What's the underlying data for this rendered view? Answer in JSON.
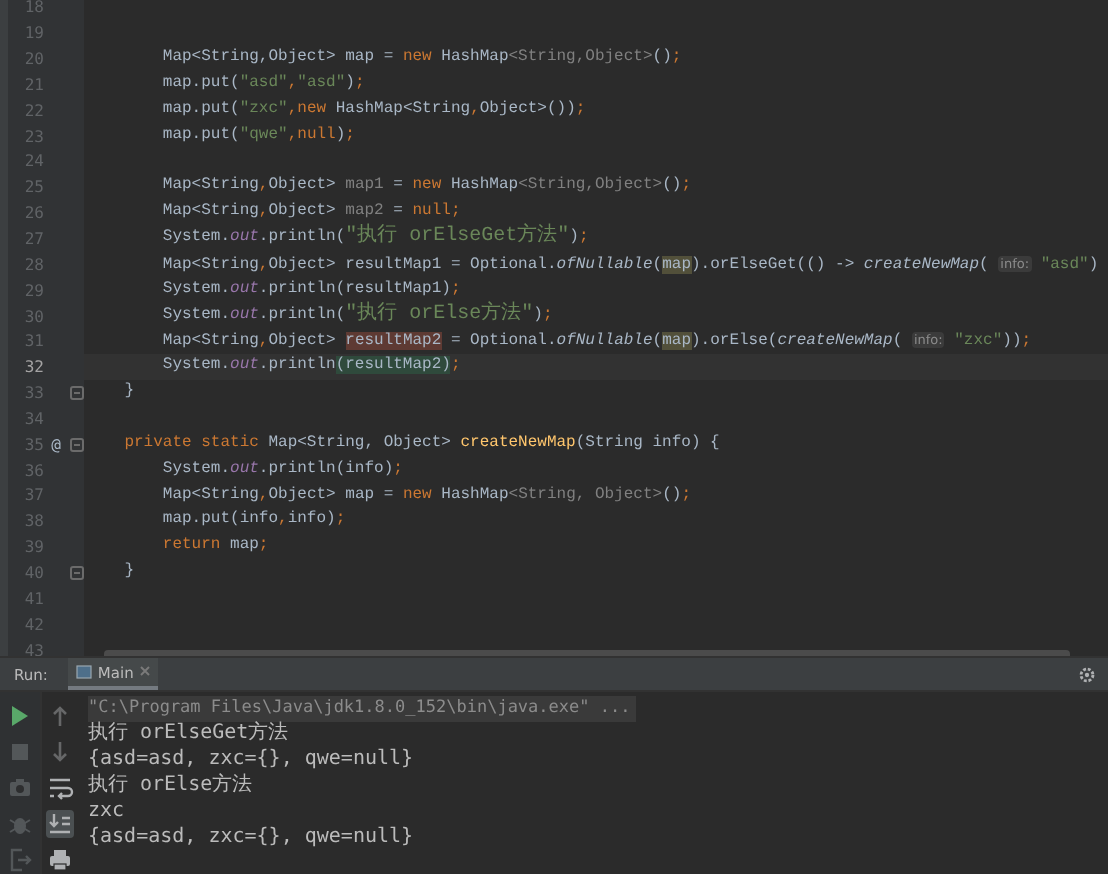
{
  "editor": {
    "lines": [
      {
        "number": "18",
        "current": false,
        "fold": false
      },
      {
        "number": "19",
        "current": false,
        "fold": false
      },
      {
        "number": "20",
        "current": false,
        "fold": false,
        "tokens": [
          {
            "kind": "plain",
            "text": "        Map<String,Object> map = "
          },
          {
            "kind": "keyword",
            "text": "new "
          },
          {
            "kind": "plain",
            "text": "HashMap"
          },
          {
            "kind": "dim",
            "text": "<String,Object>"
          },
          {
            "kind": "plain",
            "text": "()"
          },
          {
            "kind": "keyword",
            "text": ";"
          }
        ]
      },
      {
        "number": "21",
        "current": false,
        "fold": false,
        "tokens": [
          {
            "kind": "plain",
            "text": "        map.put("
          },
          {
            "kind": "string",
            "text": "\"asd\""
          },
          {
            "kind": "keyword",
            "text": ","
          },
          {
            "kind": "string",
            "text": "\"asd\""
          },
          {
            "kind": "plain",
            "text": ")"
          },
          {
            "kind": "keyword",
            "text": ";"
          }
        ]
      },
      {
        "number": "22",
        "current": false,
        "fold": false,
        "tokens": [
          {
            "kind": "plain",
            "text": "        map.put("
          },
          {
            "kind": "string",
            "text": "\"zxc\""
          },
          {
            "kind": "keyword",
            "text": ","
          },
          {
            "kind": "keyword",
            "text": "new "
          },
          {
            "kind": "plain",
            "text": "HashMap<String"
          },
          {
            "kind": "keyword",
            "text": ","
          },
          {
            "kind": "plain",
            "text": "Object>())"
          },
          {
            "kind": "keyword",
            "text": ";"
          }
        ]
      },
      {
        "number": "23",
        "current": false,
        "fold": false,
        "tokens": [
          {
            "kind": "plain",
            "text": "        map.put("
          },
          {
            "kind": "string",
            "text": "\"qwe\""
          },
          {
            "kind": "keyword",
            "text": ","
          },
          {
            "kind": "keyword",
            "text": "null"
          },
          {
            "kind": "plain",
            "text": ")"
          },
          {
            "kind": "keyword",
            "text": ";"
          }
        ]
      },
      {
        "number": "24",
        "current": false,
        "fold": false
      },
      {
        "number": "25",
        "current": false,
        "fold": false,
        "tokens": [
          {
            "kind": "plain",
            "text": "        Map<String"
          },
          {
            "kind": "keyword",
            "text": ","
          },
          {
            "kind": "plain",
            "text": "Object> "
          },
          {
            "kind": "dim",
            "text": "map1"
          },
          {
            "kind": "plain",
            "text": " = "
          },
          {
            "kind": "keyword",
            "text": "new "
          },
          {
            "kind": "plain",
            "text": "HashMap"
          },
          {
            "kind": "dim",
            "text": "<String,Object>"
          },
          {
            "kind": "plain",
            "text": "()"
          },
          {
            "kind": "keyword",
            "text": ";"
          }
        ]
      },
      {
        "number": "26",
        "current": false,
        "fold": false,
        "tokens": [
          {
            "kind": "plain",
            "text": "        Map<String"
          },
          {
            "kind": "keyword",
            "text": ","
          },
          {
            "kind": "plain",
            "text": "Object> "
          },
          {
            "kind": "dim",
            "text": "map2"
          },
          {
            "kind": "plain",
            "text": " = "
          },
          {
            "kind": "keyword",
            "text": "null;"
          }
        ]
      },
      {
        "number": "27",
        "current": false,
        "fold": false,
        "tokens": [
          {
            "kind": "plain",
            "text": "        System."
          },
          {
            "kind": "field",
            "text": "out"
          },
          {
            "kind": "plain",
            "text": ".println("
          },
          {
            "kind": "cjk-string",
            "text": "\"执行 orElseGet方法\""
          },
          {
            "kind": "plain",
            "text": ")"
          },
          {
            "kind": "keyword",
            "text": ";"
          }
        ]
      },
      {
        "number": "28",
        "current": false,
        "fold": false,
        "tokens": [
          {
            "kind": "plain",
            "text": "        Map<String"
          },
          {
            "kind": "keyword",
            "text": ","
          },
          {
            "kind": "plain",
            "text": "Object> resultMap1 = Optional."
          },
          {
            "kind": "italic",
            "text": "ofNullable"
          },
          {
            "kind": "plain",
            "text": "("
          },
          {
            "kind": "read",
            "text": "map"
          },
          {
            "kind": "plain",
            "text": ").orElseGet(() -> "
          },
          {
            "kind": "italic",
            "text": "createNewMap"
          },
          {
            "kind": "plain",
            "text": "( "
          },
          {
            "kind": "hint",
            "text": "info:"
          },
          {
            "kind": "string",
            "text": " \"asd\""
          },
          {
            "kind": "plain",
            "text": ")"
          }
        ]
      },
      {
        "number": "29",
        "current": false,
        "fold": false,
        "tokens": [
          {
            "kind": "plain",
            "text": "        System."
          },
          {
            "kind": "field",
            "text": "out"
          },
          {
            "kind": "plain",
            "text": ".println(resultMap1)"
          },
          {
            "kind": "keyword",
            "text": ";"
          }
        ]
      },
      {
        "number": "30",
        "current": false,
        "fold": false,
        "tokens": [
          {
            "kind": "plain",
            "text": "        System."
          },
          {
            "kind": "field",
            "text": "out"
          },
          {
            "kind": "plain",
            "text": ".println("
          },
          {
            "kind": "cjk-string",
            "text": "\"执行 orElse方法\""
          },
          {
            "kind": "plain",
            "text": ")"
          },
          {
            "kind": "keyword",
            "text": ";"
          }
        ]
      },
      {
        "number": "31",
        "current": false,
        "fold": false,
        "tokens": [
          {
            "kind": "plain",
            "text": "        Map<String"
          },
          {
            "kind": "keyword",
            "text": ","
          },
          {
            "kind": "plain",
            "text": "Object> "
          },
          {
            "kind": "write",
            "text": "resultMap2"
          },
          {
            "kind": "plain",
            "text": " = Optional."
          },
          {
            "kind": "italic",
            "text": "ofNullable"
          },
          {
            "kind": "plain",
            "text": "("
          },
          {
            "kind": "read",
            "text": "map"
          },
          {
            "kind": "plain",
            "text": ").orElse("
          },
          {
            "kind": "italic",
            "text": "createNewMap"
          },
          {
            "kind": "plain",
            "text": "( "
          },
          {
            "kind": "hint",
            "text": "info:"
          },
          {
            "kind": "string",
            "text": " \"zxc\""
          },
          {
            "kind": "plain",
            "text": "))"
          },
          {
            "kind": "keyword",
            "text": ";"
          }
        ]
      },
      {
        "number": "32",
        "current": true,
        "fold": false,
        "tokens": [
          {
            "kind": "plain",
            "text": "        System."
          },
          {
            "kind": "field",
            "text": "out"
          },
          {
            "kind": "plain",
            "text": ".println"
          },
          {
            "kind": "brace",
            "text": "(resultMap2)"
          },
          {
            "kind": "keyword",
            "text": ";"
          }
        ]
      },
      {
        "number": "33",
        "current": false,
        "fold": true,
        "tokens": [
          {
            "kind": "plain",
            "text": "    }"
          }
        ]
      },
      {
        "number": "34",
        "current": false,
        "fold": false
      },
      {
        "number": "35",
        "current": false,
        "fold": true,
        "gutter_mark": "@",
        "tokens": [
          {
            "kind": "keyword",
            "text": "    private static "
          },
          {
            "kind": "plain",
            "text": "Map<String, Object> "
          },
          {
            "kind": "method",
            "text": "createNewMap"
          },
          {
            "kind": "plain",
            "text": "(String info) {"
          }
        ]
      },
      {
        "number": "36",
        "current": false,
        "fold": false,
        "tokens": [
          {
            "kind": "plain",
            "text": "        System."
          },
          {
            "kind": "field",
            "text": "out"
          },
          {
            "kind": "plain",
            "text": ".println(info)"
          },
          {
            "kind": "keyword",
            "text": ";"
          }
        ]
      },
      {
        "number": "37",
        "current": false,
        "fold": false,
        "tokens": [
          {
            "kind": "plain",
            "text": "        Map<String"
          },
          {
            "kind": "keyword",
            "text": ","
          },
          {
            "kind": "plain",
            "text": "Object> map = "
          },
          {
            "kind": "keyword",
            "text": "new "
          },
          {
            "kind": "plain",
            "text": "HashMap"
          },
          {
            "kind": "dim",
            "text": "<String, Object>"
          },
          {
            "kind": "plain",
            "text": "()"
          },
          {
            "kind": "keyword",
            "text": ";"
          }
        ]
      },
      {
        "number": "38",
        "current": false,
        "fold": false,
        "tokens": [
          {
            "kind": "plain",
            "text": "        map.put(info"
          },
          {
            "kind": "keyword",
            "text": ","
          },
          {
            "kind": "plain",
            "text": "info)"
          },
          {
            "kind": "keyword",
            "text": ";"
          }
        ]
      },
      {
        "number": "39",
        "current": false,
        "fold": false,
        "tokens": [
          {
            "kind": "keyword",
            "text": "        return "
          },
          {
            "kind": "plain",
            "text": "map"
          },
          {
            "kind": "keyword",
            "text": ";"
          }
        ]
      },
      {
        "number": "40",
        "current": false,
        "fold": true,
        "tokens": [
          {
            "kind": "plain",
            "text": "    }"
          }
        ]
      },
      {
        "number": "41",
        "current": false,
        "fold": false
      },
      {
        "number": "42",
        "current": false,
        "fold": false
      },
      {
        "number": "43",
        "current": false,
        "fold": false
      }
    ]
  },
  "run_panel": {
    "label": "Run:",
    "tabs": [
      {
        "label": "Main",
        "selected": true
      }
    ],
    "tools_left": [
      {
        "kind": "run",
        "disabled": false
      },
      {
        "kind": "stop",
        "disabled": true
      },
      {
        "kind": "camera",
        "disabled": true
      },
      {
        "kind": "bug",
        "disabled": true
      },
      {
        "kind": "exit",
        "disabled": true
      }
    ],
    "tools_right": [
      {
        "kind": "up",
        "disabled": true,
        "on": false
      },
      {
        "kind": "down",
        "disabled": true,
        "on": false
      },
      {
        "kind": "wrap",
        "disabled": false,
        "on": false
      },
      {
        "kind": "scroll-end",
        "disabled": false,
        "on": true
      },
      {
        "kind": "print",
        "disabled": false,
        "on": false
      }
    ],
    "console": [
      {
        "kind": "command",
        "text": "\"C:\\Program Files\\Java\\jdk1.8.0_152\\bin\\java.exe\" ..."
      },
      {
        "kind": "output",
        "text": "执行 orElseGet方法"
      },
      {
        "kind": "output",
        "text": "{asd=asd, zxc={}, qwe=null}"
      },
      {
        "kind": "output",
        "text": "执行 orElse方法"
      },
      {
        "kind": "output",
        "text": "zxc"
      },
      {
        "kind": "output",
        "text": "{asd=asd, zxc={}, qwe=null}"
      }
    ]
  }
}
